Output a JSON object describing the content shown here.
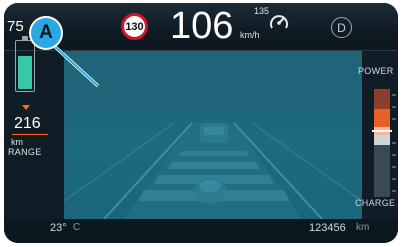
{
  "top": {
    "speed_limit": "130",
    "speed": "106",
    "speed_unit": "km/h",
    "cruise_speed": "135",
    "cruise_icon": "cruise-control-icon",
    "gear": "D"
  },
  "left": {
    "battery_percent": "75",
    "battery_percent_unit": "%",
    "battery_level": 0.75,
    "range_value": "216",
    "range_unit": "km",
    "range_label": "RANGE"
  },
  "right": {
    "power_label": "POWER",
    "charge_label": "CHARGE"
  },
  "bottom": {
    "temperature_value": "23°",
    "temperature_unit": "C",
    "odometer_value": "123456",
    "odometer_unit": "km"
  },
  "callout": {
    "label": "A"
  },
  "colors": {
    "speed_limit_ring": "#d0142a",
    "battery_fill": "#39c8a5",
    "accent_orange": "#ff6a1f",
    "callout_blue": "#2aa8e3",
    "display_teal": "#1f6a7e"
  }
}
